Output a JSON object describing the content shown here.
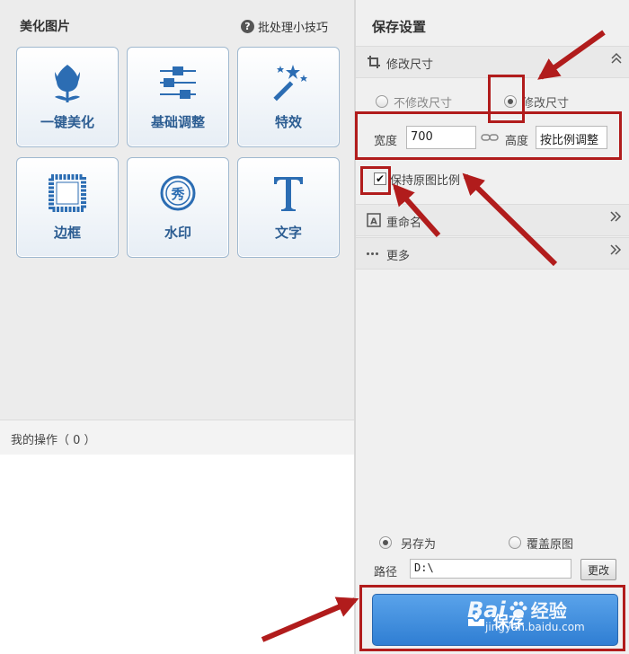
{
  "left": {
    "title": "美化图片",
    "tips_label": "批处理小技巧",
    "tools": [
      {
        "label": "一键美化",
        "icon": "tulip-icon"
      },
      {
        "label": "基础调整",
        "icon": "sliders-icon"
      },
      {
        "label": "特效",
        "icon": "magic-wand-icon"
      },
      {
        "label": "边框",
        "icon": "frame-icon"
      },
      {
        "label": "水印",
        "icon": "watermark-icon"
      },
      {
        "label": "文字",
        "icon": "text-icon"
      }
    ],
    "my_ops": "我的操作（ 0 ）"
  },
  "right": {
    "title": "保存设置",
    "resize_section": {
      "header": "修改尺寸",
      "option_keep": "不修改尺寸",
      "option_resize": "修改尺寸",
      "selected": "修改尺寸",
      "width_label": "宽度",
      "width_value": "700",
      "height_label": "高度",
      "height_value": "按比例调整",
      "keep_ratio_label": "保持原图比例",
      "keep_ratio_checked": true
    },
    "rename_section": {
      "header": "重命名"
    },
    "more_section": {
      "header": "更多"
    },
    "save_mode": {
      "save_as": "另存为",
      "overwrite": "覆盖原图",
      "selected": "另存为"
    },
    "path_label": "路径",
    "path_value": "D:\\",
    "change_button": "更改",
    "save_button": "保存"
  },
  "watermark": {
    "brand": "Bai",
    "brand_suffix": "经验",
    "url": "jingyan.baidu.com"
  },
  "colors": {
    "accent_blue": "#2f7ed3",
    "icon_blue": "#2c6db3",
    "annotation_red": "#b11c1c"
  }
}
